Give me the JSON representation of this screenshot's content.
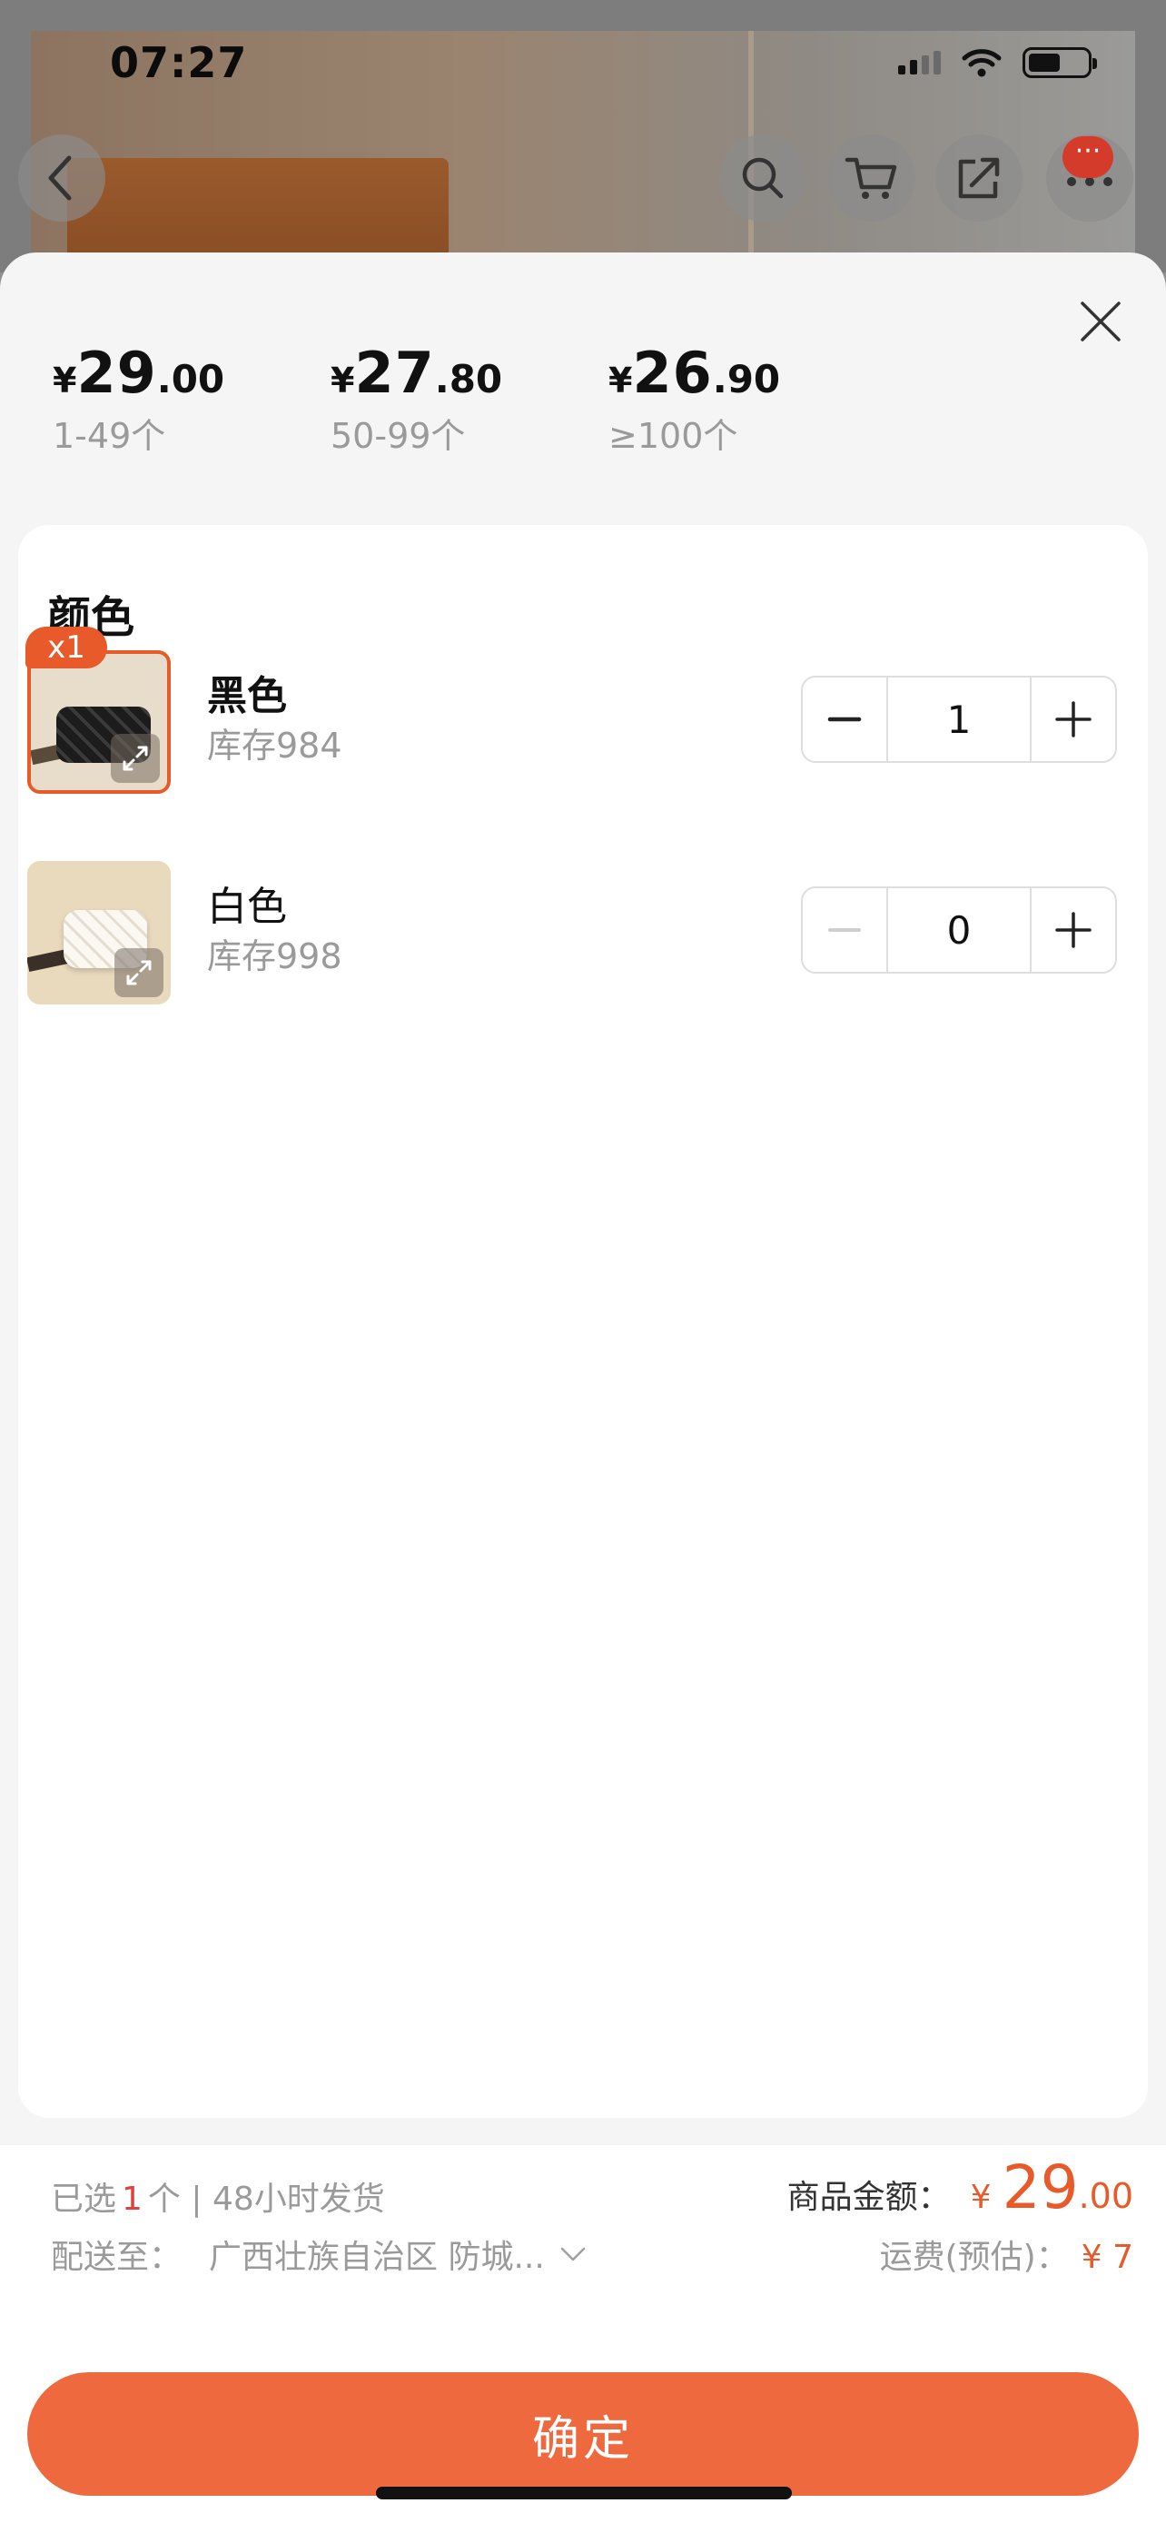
{
  "status_bar": {
    "time": "07:27"
  },
  "background_nav": {
    "more_badge": "···"
  },
  "price_tiers": [
    {
      "currency": "¥",
      "integer": "29",
      "decimal": ".00",
      "range": "1-49个"
    },
    {
      "currency": "¥",
      "integer": "27",
      "decimal": ".80",
      "range": "50-99个"
    },
    {
      "currency": "¥",
      "integer": "26",
      "decimal": ".90",
      "range": "≥100个"
    }
  ],
  "section": {
    "title": "颜色"
  },
  "variants": [
    {
      "name": "黑色",
      "stock": "库存984",
      "quantity": "1",
      "badge": "x1",
      "selected": true
    },
    {
      "name": "白色",
      "stock": "库存998",
      "quantity": "0",
      "selected": false
    }
  ],
  "footer": {
    "selected_prefix": "已选",
    "selected_count": "1",
    "selected_suffix": "个 | 48小时发货",
    "ship_label": "配送至：",
    "ship_address": "广西壮族自治区 防城...",
    "total_label": "商品金额：",
    "total_currency": "¥",
    "total_integer": "29",
    "total_decimal": ".00",
    "freight_label": "运费(预估)：",
    "freight_value": "¥ 7",
    "confirm_label": "确定"
  },
  "colors": {
    "accent": "#ee6a3e",
    "price_red": "#e85a2a",
    "count_red": "#e0413a"
  }
}
